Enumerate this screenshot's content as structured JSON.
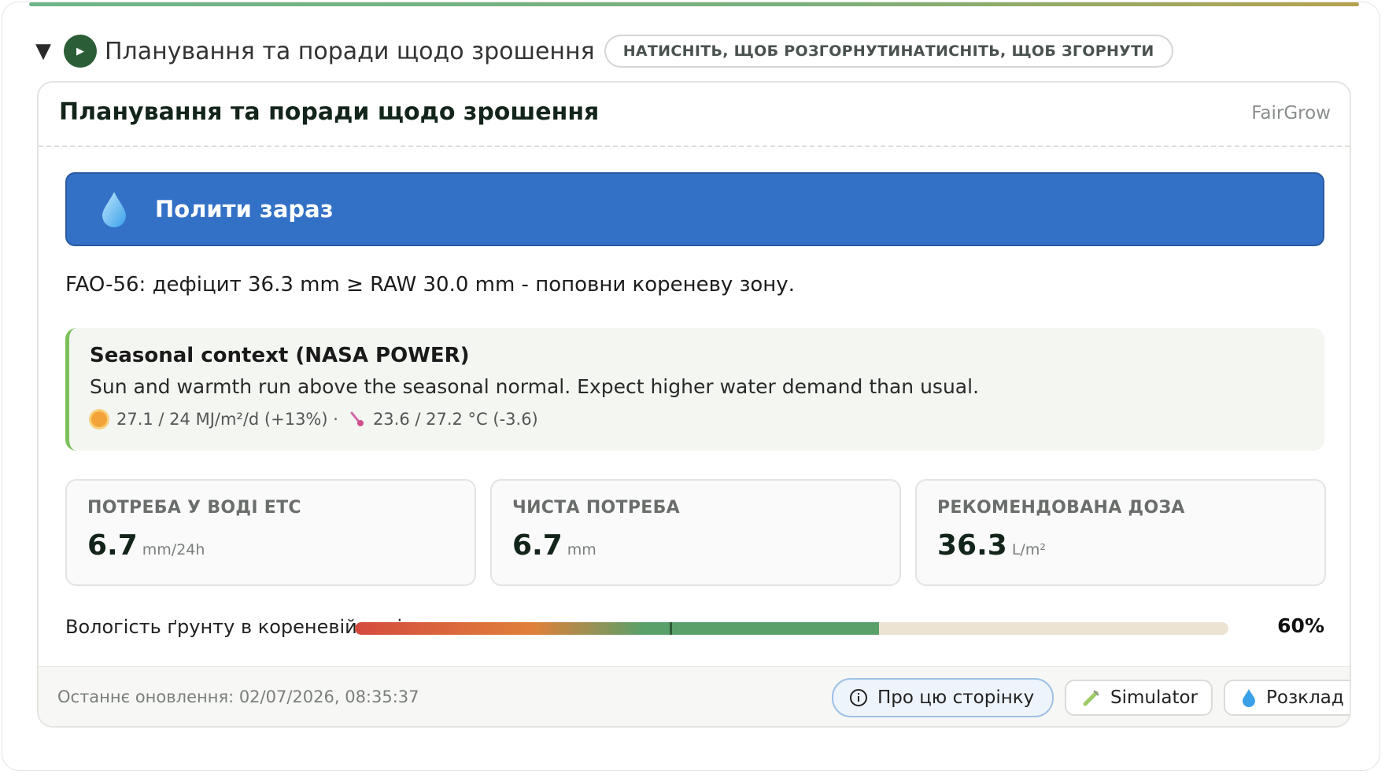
{
  "summary": {
    "title": "Планування та поради щодо зрошення",
    "toggle_hint": "НАТИСНІТЬ, ЩОБ РОЗГОРНУТИНАТИСНІТЬ, ЩОБ ЗГОРНУТИ",
    "expanded_icon": "triangle-down-icon",
    "play_icon": "play-icon"
  },
  "card": {
    "title": "Планування та поради щодо зрошення",
    "brand": "FairGrow"
  },
  "banner": {
    "label": "Полити зараз",
    "icon": "water-drop-icon",
    "color": "#3371c6"
  },
  "fao_text": "FAO-56: дефіцит 36.3 mm ≥ RAW 30.0 mm - поповни кореневу зону.",
  "season": {
    "title": "Seasonal context (NASA POWER)",
    "text": "Sun and warmth run above the seasonal normal. Expect higher water demand than usual.",
    "solar": "27.1 / 24 MJ/m²/d (+13%) ·",
    "temp": "23.6 / 27.2 °C (-3.6)",
    "accent": "#7bc15a"
  },
  "metrics": [
    {
      "label": "ПОТРЕБА У ВОДІ ETC",
      "value": "6.7",
      "unit": "mm/24h"
    },
    {
      "label": "ЧИСТА ПОТРЕБА",
      "value": "6.7",
      "unit": "mm"
    },
    {
      "label": "РЕКОМЕНДОВАНА ДОЗА",
      "value": "36.3",
      "unit": "L/m²"
    }
  ],
  "moisture": {
    "label": "Вологість ґрунту в кореневій зоні",
    "percent_text": "60%",
    "value_fraction": 0.6,
    "threshold_fraction": 0.36
  },
  "footer": {
    "updated": "Останнє оновлення: 02/07/2026, 08:35:37",
    "about_label": "Про цю сторінку",
    "simulator_label": "Simulator",
    "schedule_label": "Розклад"
  }
}
